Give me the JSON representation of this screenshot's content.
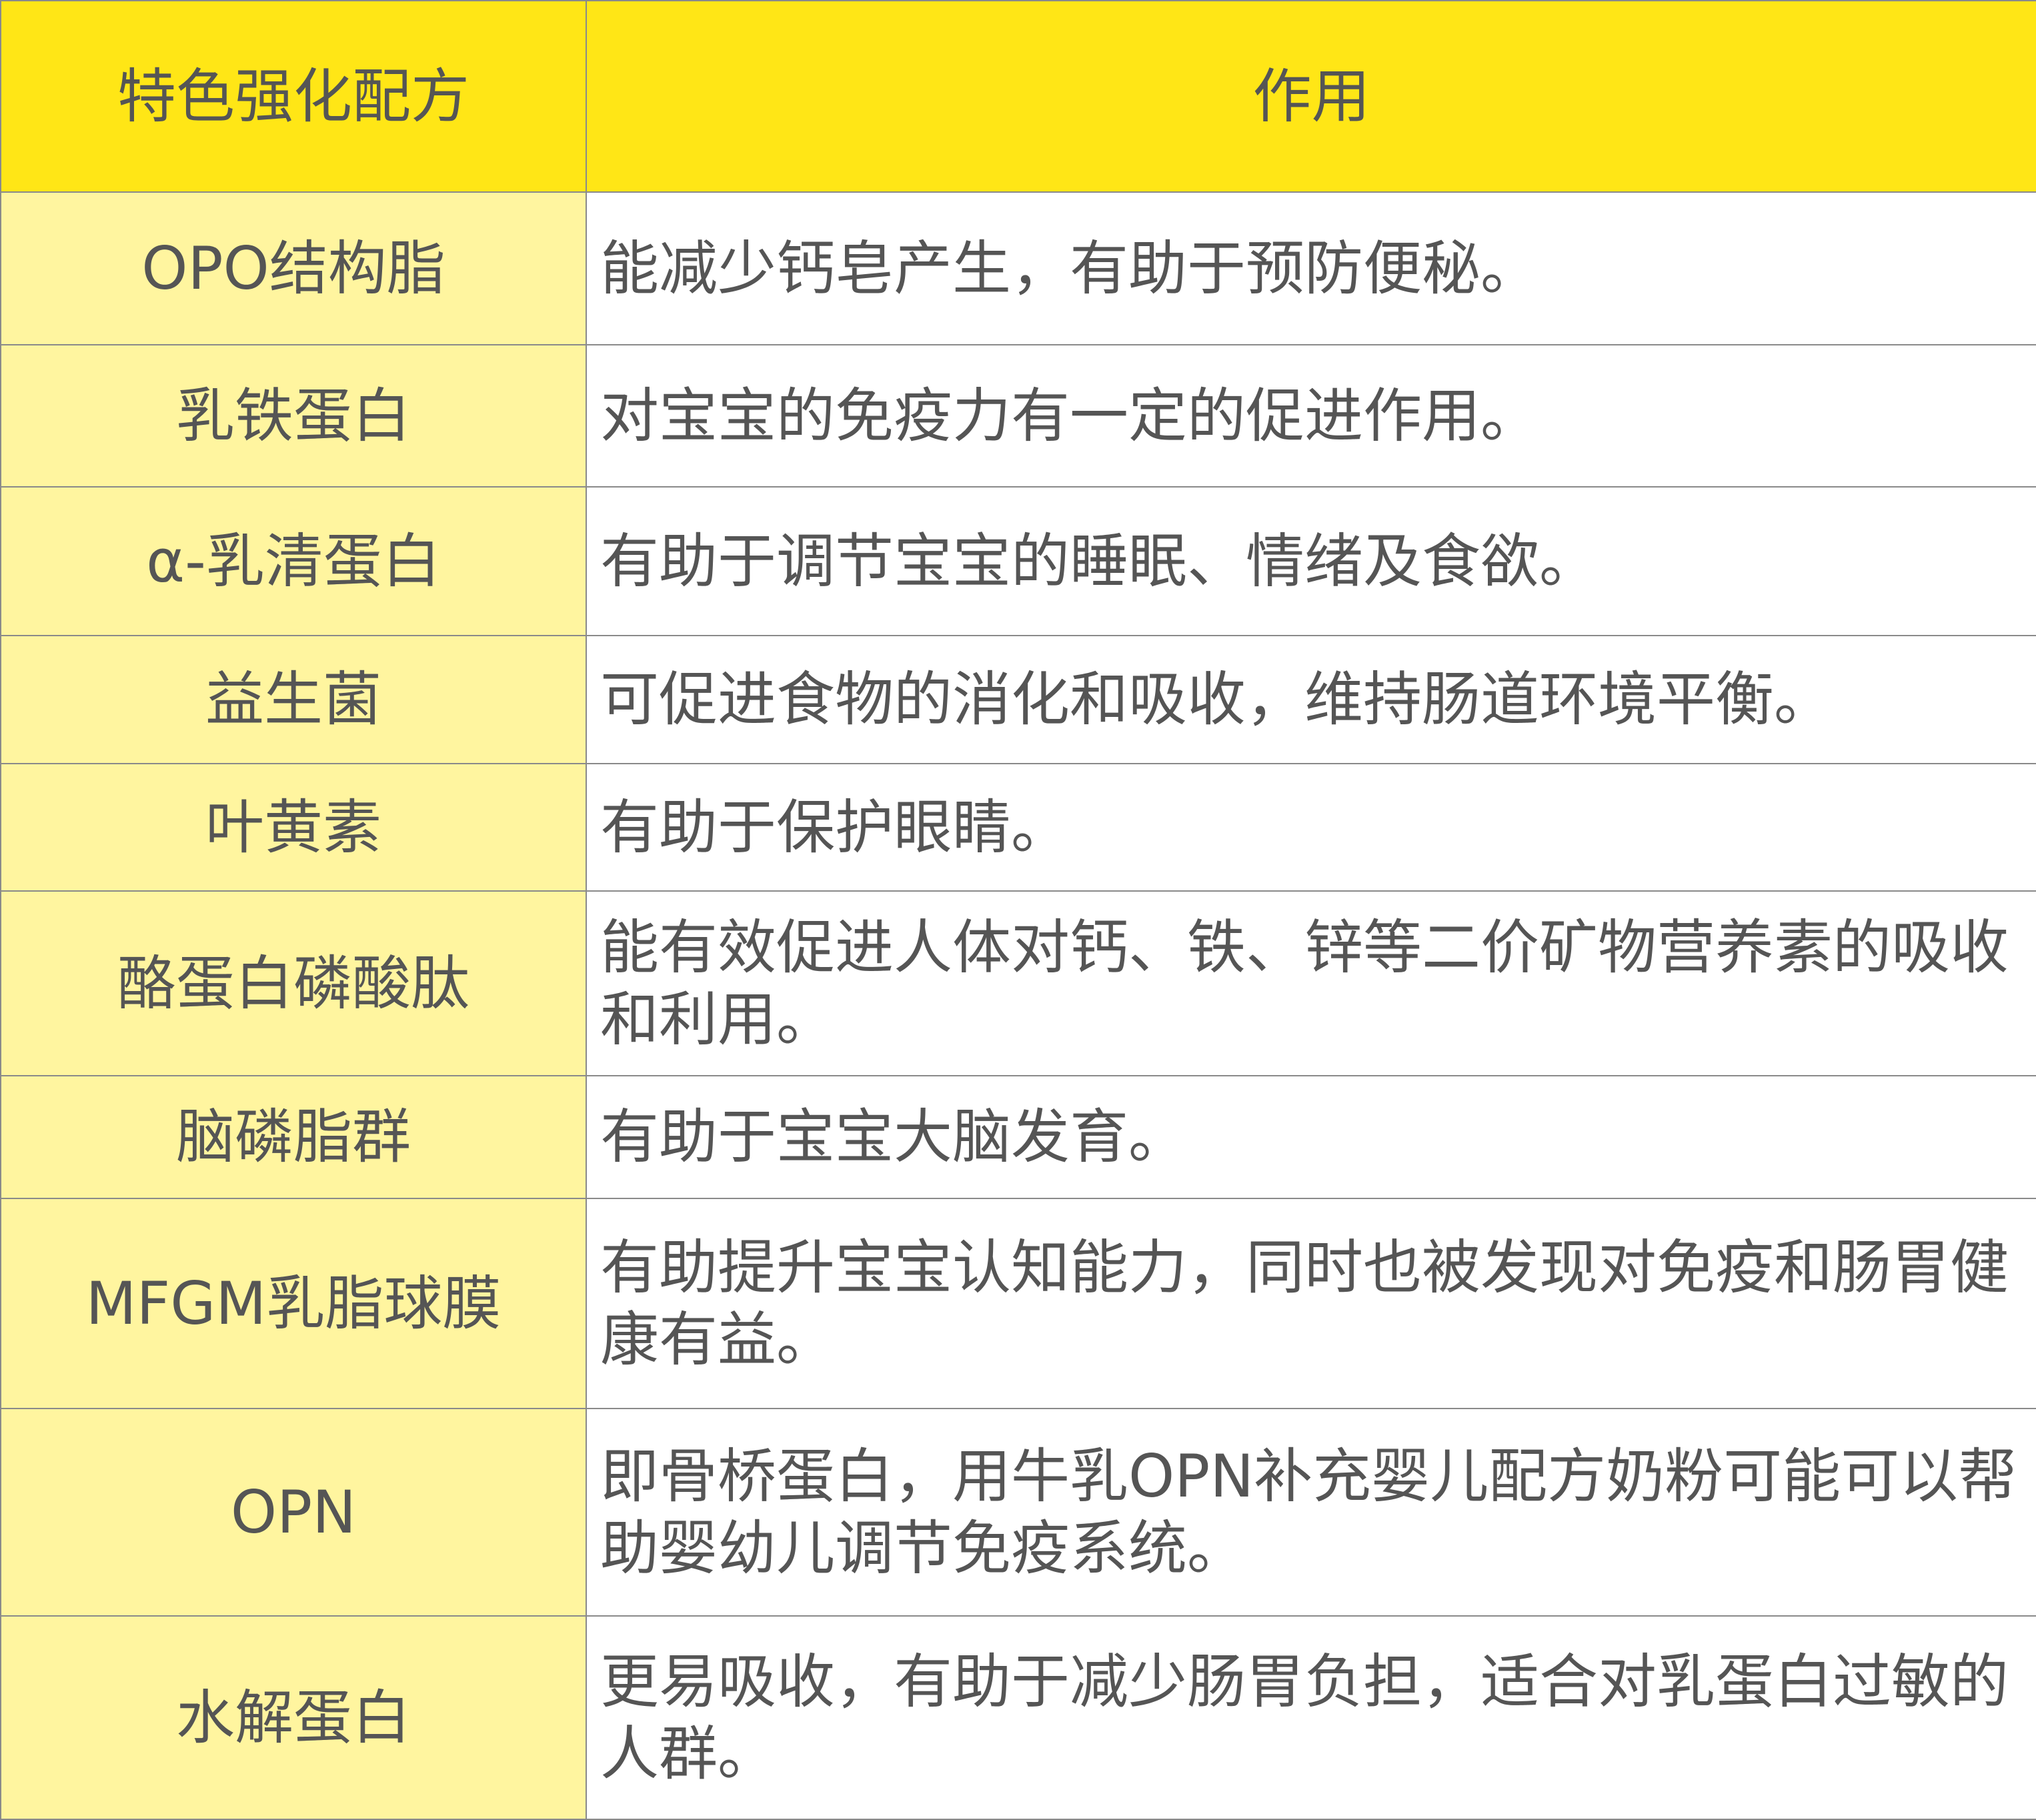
{
  "header": {
    "col1": "特色强化配方",
    "col2": "作用"
  },
  "rows": [
    {
      "name": "OPO结构脂",
      "effect": "能减少钙皂产生，有助于预防便秘。"
    },
    {
      "name": "乳铁蛋白",
      "effect": "对宝宝的免疫力有一定的促进作用。"
    },
    {
      "name": "α-乳清蛋白",
      "effect": "有助于调节宝宝的睡眠、情绪及食欲。"
    },
    {
      "name": "益生菌",
      "effect": "可促进食物的消化和吸收，维持肠道环境平衡。"
    },
    {
      "name": "叶黄素",
      "effect": "有助于保护眼睛。"
    },
    {
      "name": "酪蛋白磷酸肽",
      "effect": "能有效促进人体对钙、铁、锌等二价矿物营养素的吸收和利用。"
    },
    {
      "name": "脑磷脂群",
      "effect": "有助于宝宝大脑发育。"
    },
    {
      "name": "MFGM乳脂球膜",
      "effect": "有助提升宝宝认知能力，同时也被发现对免疫和肠胃健康有益。"
    },
    {
      "name": "OPN",
      "effect": "即骨桥蛋白，用牛乳OPN补充婴儿配方奶粉可能可以帮助婴幼儿调节免疫系统。"
    },
    {
      "name": "水解蛋白",
      "effect": "更易吸收，有助于减少肠胃负担，适合对乳蛋白过敏的人群。"
    }
  ],
  "colors": {
    "header_bg": "#ffe616",
    "name_col_bg": "#fff59f",
    "effect_col_bg": "#ffffff",
    "text": "#555555",
    "border": "#8a8a8a"
  }
}
